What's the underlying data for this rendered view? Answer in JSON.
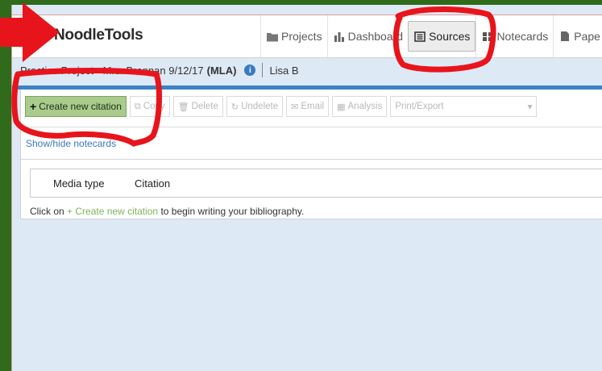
{
  "app": {
    "logo": "NoodleTools"
  },
  "nav": {
    "items": [
      {
        "label": "Projects",
        "icon": "folder-icon",
        "active": false
      },
      {
        "label": "Dashboard",
        "icon": "bar-chart-icon",
        "active": false
      },
      {
        "label": "Sources",
        "icon": "list-icon",
        "active": true
      },
      {
        "label": "Notecards",
        "icon": "notecards-icon",
        "active": false
      },
      {
        "label": "Pape",
        "icon": "paper-icon",
        "active": false
      }
    ]
  },
  "project": {
    "name": "Practice Project - Mrs. Brennan 9/12/17",
    "style": "(MLA)",
    "user": "Lisa B"
  },
  "toolbar": {
    "create": "Create new citation",
    "copy": "Copy",
    "delete": "Delete",
    "undelete": "Undelete",
    "email": "Email",
    "analysis": "Analysis",
    "print_export": "Print/Export"
  },
  "notecards_toggle": "Show/hide notecards",
  "table": {
    "columns": [
      "Media type",
      "Citation"
    ]
  },
  "empty": {
    "prefix": "Click on",
    "cta": "+ Create new citation",
    "suffix": "to begin writing your bibliography."
  },
  "colors": {
    "brand_blue": "#3c82c7",
    "create_green": "#a9cc8c",
    "annotation_red": "#e8141c",
    "frame_green": "#2f6b1a"
  }
}
